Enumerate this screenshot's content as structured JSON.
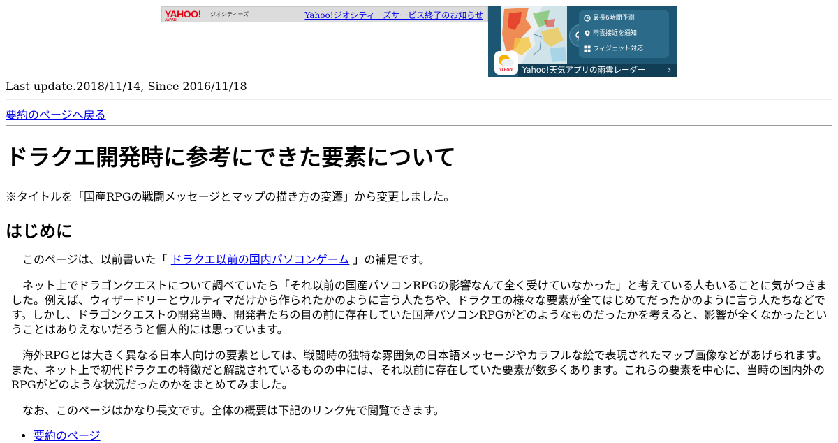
{
  "geocities_bar": {
    "logo": "YAHOO!",
    "logo_sub": "JAPAN",
    "service": "ジオシティーズ",
    "notice_link": "Yahoo!ジオシティーズサービス終了のお知らせ"
  },
  "weather_ad": {
    "app_icon_label": "YAHOO!",
    "features": [
      "最長6時間予測",
      "雨雲接近を通知",
      "ウィジェット対応"
    ],
    "bottom_text": "Yahoo!天気アプリの雨雲レーダー",
    "chevron": "›"
  },
  "page": {
    "last_update": "Last update.2018/11/14, Since 2016/11/18",
    "back_link": "要約のページへ戻る",
    "title": "ドラクエ開発時に参考にできた要素について",
    "title_note": "※タイトルを「国産RPGの戦闘メッセージとマップの描き方の変遷」から変更しました。",
    "section_heading": "はじめに",
    "p1_before": "このページは、以前書いた「",
    "p1_link": "ドラクエ以前の国内パソコンゲーム",
    "p1_after": "」の補足です。",
    "p2": "ネット上でドラゴンクエストについて調べていたら「それ以前の国産パソコンRPGの影響なんて全く受けていなかった」と考えている人もいることに気がつきました。例えば、ウィザードリーとウルティマだけから作られたかのように言う人たちや、ドラクエの様々な要素が全てはじめてだったかのように言う人たちなどです。しかし、ドラゴンクエストの開発当時、開発者たちの目の前に存在していた国産パソコンRPGがどのようなものだったかを考えると、影響が全くなかったということはありえないだろうと個人的には思っています。",
    "p3": "海外RPGとは大きく異なる日本人向けの要素としては、戦闘時の独特な雰囲気の日本語メッセージやカラフルな絵で表現されたマップ画像などがあげられます。また、ネット上で初代ドラクエの特徴だと解説されているものの中には、それ以前に存在していた要素が数多くあります。これらの要素を中心に、当時の国内外のRPGがどのような状況だったのかをまとめてみました。",
    "p4": "なお、このページはかなり長文です。全体の概要は下記のリンク先で閲覧できます。",
    "toc": [
      "要約のページ"
    ]
  }
}
